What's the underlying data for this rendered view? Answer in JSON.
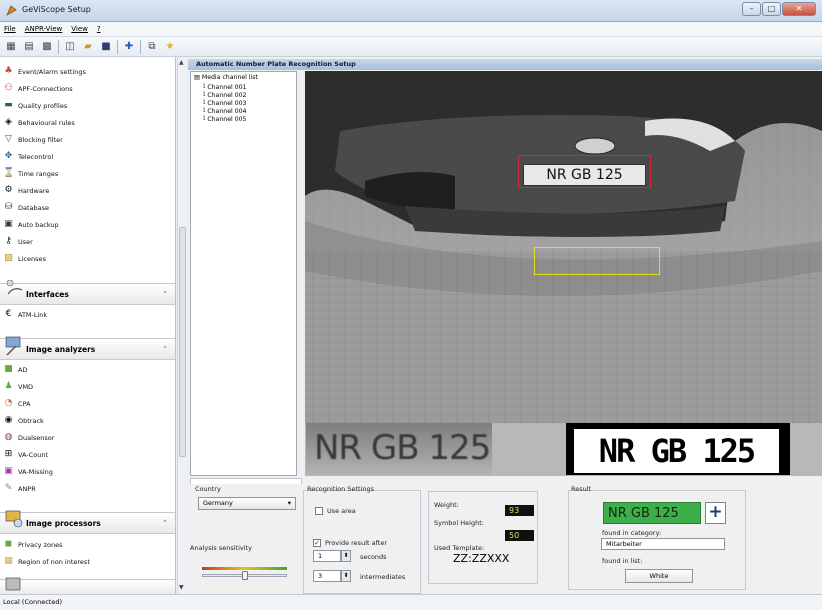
{
  "window": {
    "title": "GeViScope Setup"
  },
  "menu": [
    "File",
    "ANPR-View",
    "View",
    "?"
  ],
  "toolbar": {
    "icons": [
      "grid-icon",
      "grid-icon",
      "group-icon",
      "new-icon",
      "open-icon",
      "save-icon",
      "add-icon",
      "copy-icon",
      "star-icon"
    ]
  },
  "sidebar": {
    "items_top": [
      {
        "label": "Event/Alarm settings",
        "icon": "alarm-icon"
      },
      {
        "label": "APF-Connections",
        "icon": "connections-icon"
      },
      {
        "label": "Quality profiles",
        "icon": "quality-icon"
      },
      {
        "label": "Behavioural rules",
        "icon": "rules-icon"
      },
      {
        "label": "Blocking filter",
        "icon": "filter-icon"
      },
      {
        "label": "Telecontrol",
        "icon": "telecontrol-icon"
      },
      {
        "label": "Time ranges",
        "icon": "time-icon"
      },
      {
        "label": "Hardware",
        "icon": "hardware-icon"
      },
      {
        "label": "Database",
        "icon": "database-icon"
      },
      {
        "label": "Auto backup",
        "icon": "backup-icon"
      },
      {
        "label": "User",
        "icon": "user-icon"
      },
      {
        "label": "Licenses",
        "icon": "licenses-icon"
      }
    ],
    "groups": [
      {
        "label": "Interfaces",
        "items": [
          {
            "label": "ATM-Link"
          }
        ]
      },
      {
        "label": "Image analyzers",
        "items": [
          {
            "label": "AD"
          },
          {
            "label": "VMD"
          },
          {
            "label": "CPA"
          },
          {
            "label": "Obtrack"
          },
          {
            "label": "Dualsensor"
          },
          {
            "label": "VA-Count"
          },
          {
            "label": "VA-Missing"
          },
          {
            "label": "ANPR"
          }
        ]
      },
      {
        "label": "Image processors",
        "items": [
          {
            "label": "Privacy zones"
          },
          {
            "label": "Region of non interest"
          }
        ]
      }
    ]
  },
  "panel": {
    "title": "Automatic Number Plate Recognition Setup"
  },
  "tree": {
    "root": "Media channel list",
    "channels": [
      "Channel 001",
      "Channel 002",
      "Channel 003",
      "Channel 004",
      "Channel 005"
    ]
  },
  "image": {
    "plate_text": "NR GB 125"
  },
  "country": {
    "label": "Country",
    "value": "Germany"
  },
  "analysis": {
    "label": "Analysis sensitivity",
    "level_fraction": 0.5
  },
  "recognition": {
    "label": "Recognition Settings",
    "use_area": "Use area",
    "use_area_checked": false,
    "provide_result": "Provide result after",
    "provide_checked": true,
    "seconds_value": "1",
    "seconds_label": "seconds",
    "intermediates_value": "3",
    "intermediates_label": "intermediates"
  },
  "metrics": {
    "weight_label": "Weight:",
    "weight_value": "93",
    "symbol_height_label": "Symbol Height:",
    "symbol_height_value": "50",
    "template_label": "Used Template:",
    "template_value": "ZZ:ZZXXX"
  },
  "result": {
    "label": "Result",
    "plate": "NR GB 125",
    "plus": "+",
    "category_label": "found in category:",
    "category_value": "Mitarbeiter",
    "list_label": "found in list:",
    "list_value": "White"
  },
  "status": {
    "text": "Local (Connected)"
  }
}
